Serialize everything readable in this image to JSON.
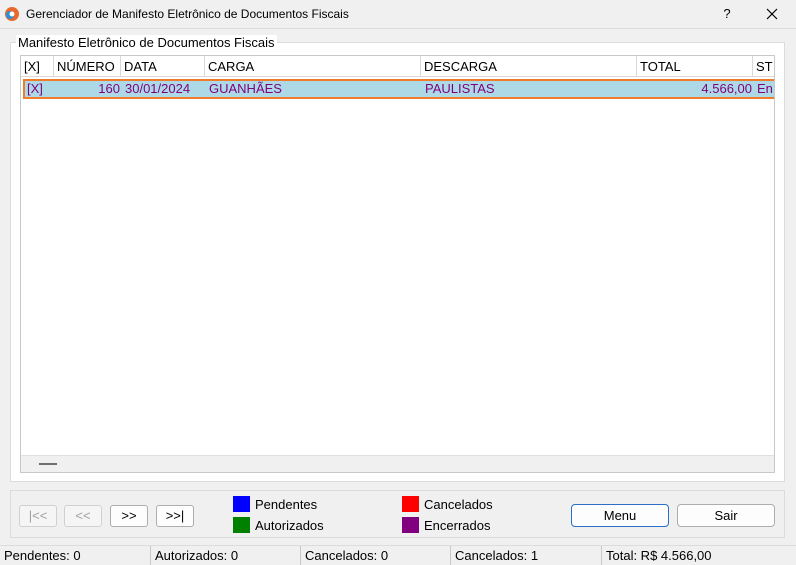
{
  "window": {
    "title": "Gerenciador de Manifesto Eletrônico de Documentos Fiscais",
    "help_label": "?"
  },
  "group": {
    "title": "Manifesto Eletrônico de Documentos Fiscais"
  },
  "grid": {
    "columns": [
      "[X]",
      "NÚMERO",
      "DATA",
      "CARGA",
      "DESCARGA",
      "TOTAL",
      "ST"
    ],
    "rows": [
      [
        "[X]",
        "160",
        "30/01/2024",
        "GUANHÃES",
        "PAULISTAS",
        "4.566,00",
        "En"
      ]
    ],
    "row_text_color": "#7f007f",
    "selected_row_bg": "#add8e6",
    "focus_border_color": "#f07b2a"
  },
  "navigation": {
    "first": "|<<",
    "prev": "<<",
    "next": ">>",
    "last": ">>|"
  },
  "legend": [
    {
      "label": "Pendentes",
      "color": "#0000ff"
    },
    {
      "label": "Autorizados",
      "color": "#008000"
    },
    {
      "label": "Cancelados",
      "color": "#ff0000"
    },
    {
      "label": "Encerrados",
      "color": "#800080"
    }
  ],
  "buttons": {
    "menu": "Menu",
    "exit": "Sair"
  },
  "status_bar": [
    "Pendentes: 0",
    "Autorizados: 0",
    "Cancelados: 0",
    "Cancelados: 1",
    "Total: R$ 4.566,00"
  ]
}
